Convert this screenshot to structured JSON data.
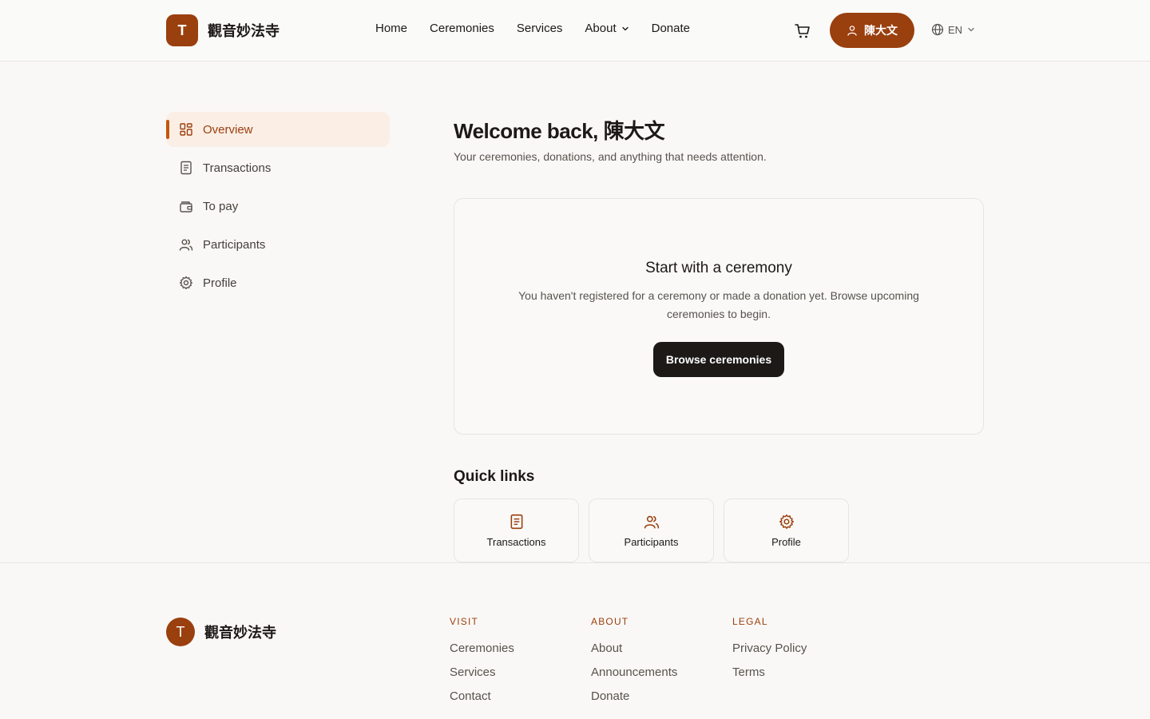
{
  "header": {
    "logo_letter": "T",
    "brand": "觀音妙法寺",
    "nav": [
      {
        "label": "Home"
      },
      {
        "label": "Ceremonies"
      },
      {
        "label": "Services"
      },
      {
        "label": "About"
      },
      {
        "label": "Donate"
      }
    ],
    "user_name": "陳大文",
    "language": "EN"
  },
  "sidebar": {
    "items": [
      {
        "label": "Overview",
        "icon": "grid-icon",
        "active": true
      },
      {
        "label": "Transactions",
        "icon": "receipt-icon"
      },
      {
        "label": "To pay",
        "icon": "wallet-icon"
      },
      {
        "label": "Participants",
        "icon": "users-icon"
      },
      {
        "label": "Profile",
        "icon": "gear-icon"
      }
    ]
  },
  "main": {
    "welcome": "Welcome back, 陳大文",
    "subtitle": "Your ceremonies, donations, and anything that needs attention.",
    "empty_state": {
      "title": "Start with a ceremony",
      "text": "You haven't registered for a ceremony or made a donation yet. Browse upcoming ceremonies to begin.",
      "button": "Browse ceremonies"
    },
    "quick_links_title": "Quick links",
    "quick_links": [
      {
        "label": "Transactions",
        "icon": "receipt-icon"
      },
      {
        "label": "Participants",
        "icon": "users-icon"
      },
      {
        "label": "Profile",
        "icon": "gear-icon"
      }
    ]
  },
  "footer": {
    "logo_letter": "T",
    "brand": "觀音妙法寺",
    "columns": [
      {
        "title": "VISIT",
        "links": [
          "Ceremonies",
          "Services",
          "Contact"
        ]
      },
      {
        "title": "ABOUT",
        "links": [
          "About",
          "Announcements",
          "Donate"
        ]
      },
      {
        "title": "LEGAL",
        "links": [
          "Privacy Policy",
          "Terms"
        ]
      }
    ]
  },
  "colors": {
    "brand": "#9a3f0e",
    "accent": "#c2570f",
    "dark_button": "#1c1917",
    "background": "#faf8f6"
  }
}
